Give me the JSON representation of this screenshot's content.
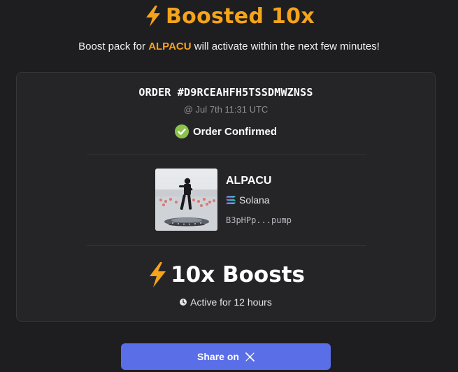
{
  "header": {
    "title": "Boosted 10x",
    "bolt_icon": "lightning-bolt-icon",
    "accent_color": "#f5a31a"
  },
  "subtitle": {
    "prefix": "Boost pack for ",
    "token": "ALPACU",
    "suffix": " will activate within the next few minutes!"
  },
  "order": {
    "id": "ORDER #D9RCEAHFH5TSSDMWZNSS",
    "timestamp": "@ Jul 7th 11:31 UTC",
    "status": "Order Confirmed",
    "status_icon": "check-circle-icon",
    "status_color": "#8bc34a"
  },
  "token": {
    "name": "ALPACU",
    "chain": "Solana",
    "chain_icon": "solana-icon",
    "address": "B3pHPp...pump"
  },
  "boost": {
    "label": "10x Boosts",
    "duration": "Active for 12 hours",
    "duration_icon": "clock-icon"
  },
  "share": {
    "label": "Share on",
    "icon": "x-logo-icon",
    "button_color": "#5a6ee8"
  }
}
